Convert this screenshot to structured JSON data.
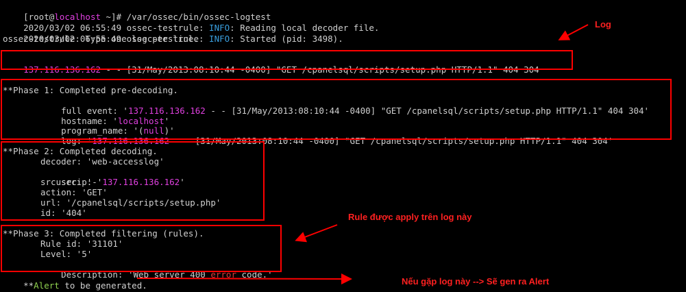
{
  "terminal": {
    "prompt": {
      "user": "[root@",
      "host": "localhost",
      "path": " ~]# /var/ossec/bin/ossec-logtest"
    },
    "header_lines": [
      {
        "prefix": "2020/03/02 06:55:49 ossec-testrule: ",
        "level": "INFO",
        "message": ": Reading local decoder file."
      },
      {
        "prefix": "2020/03/02 06:55:49 ossec-testrule: ",
        "level": "INFO",
        "message": ": Started (pid: 3498)."
      }
    ],
    "type_prompt": "ossec-testrule: Type one log per line.",
    "log_line": {
      "ip": "137.116.136.162",
      "rest": " - - [31/May/2013:08:10:44 -0400] \"GET /cpanelsql/scripts/setup.php HTTP/1.1\" 404 304"
    },
    "phase1": {
      "title": "**Phase 1: Completed pre-decoding.",
      "full_event_label": "full event: '",
      "full_event_ip": "137.116.136.162",
      "full_event_rest": " - - [31/May/2013:08:10:44 -0400] \"GET /cpanelsql/scripts/setup.php HTTP/1.1\" 404 304'",
      "hostname_label": "hostname: '",
      "hostname_value": "localhost",
      "hostname_end": "'",
      "program_label": "program_name: '(",
      "program_value": "null",
      "program_end": ")'",
      "log_label": "log: '",
      "log_ip": "137.116.136.162",
      "log_rest": " - - [31/May/2013:08:10:44 -0400] \"GET /cpanelsql/scripts/setup.php HTTP/1.1\" 404 304'"
    },
    "phase2": {
      "title": "**Phase 2: Completed decoding.",
      "decoder": "decoder: 'web-accesslog'",
      "srcip_label": "srcip: '",
      "srcip_value": "137.116.136.162",
      "srcip_end": "'",
      "srcuser": "srcuser: '-'",
      "action": "action: 'GET'",
      "url": "url: '/cpanelsql/scripts/setup.php'",
      "id": "id: '404'"
    },
    "phase3": {
      "title": "**Phase 3: Completed filtering (rules).",
      "rule_id": "Rule id: '31101'",
      "level": "Level: '5'",
      "desc_label": "Description: 'Web server 400 ",
      "desc_error": "error",
      "desc_end": " code.'"
    },
    "alert": {
      "prefix": "**",
      "word": "Alert",
      "rest": " to be generated."
    }
  },
  "annotations": {
    "log_note": "Log",
    "rule_note": "Rule được apply trên log này",
    "alert_note": "Nếu gặp log này --> Sẽ gen ra Alert"
  },
  "colors": {
    "text": "#d0d0d0",
    "magenta": "#e040e0",
    "cyan": "#3aa0e0",
    "red": "#e03a3a",
    "annotation": "#ff0000"
  }
}
